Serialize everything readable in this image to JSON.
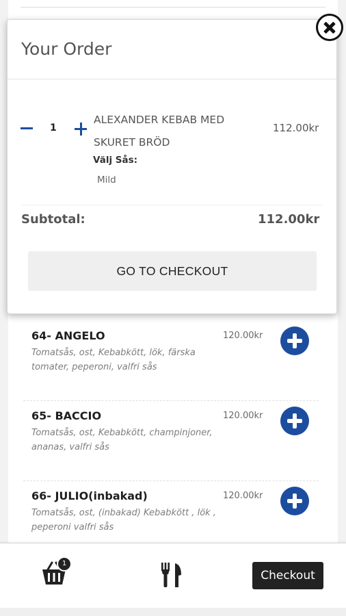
{
  "order": {
    "title": "Your Order",
    "items": [
      {
        "quantity": "1",
        "name": "ALEXANDER KEBAB MED SKURET BRÖD",
        "price": "112.00kr",
        "option_label": "Välj Sås:",
        "option_value": "Mild"
      }
    ],
    "subtotal_label": "Subtotal:",
    "subtotal_value": "112.00kr",
    "checkout_button": "GO TO CHECKOUT"
  },
  "menu": {
    "items": [
      {
        "name": "64- ANGELO",
        "description": "Tomatsås, ost, Kebabkött, lök, färska tomater, peperoni, valfri sås",
        "price": "120.00kr"
      },
      {
        "name": "65- BACCIO",
        "description": "Tomatsås, ost, Kebabkött, champinjoner, ananas, valfri sås",
        "price": "120.00kr"
      },
      {
        "name": "66- JULIO(inbakad)",
        "description": "Tomatsås, ost, (inbakad) Kebabkött , lök , peperoni valfri sås",
        "price": "120.00kr"
      }
    ]
  },
  "bottom_nav": {
    "cart_badge": "1",
    "checkout_label": "Checkout",
    "icons": [
      "cart-icon",
      "cutlery-icon"
    ]
  },
  "colors": {
    "accent_blue": "#1d4d9e",
    "dark": "#222222"
  }
}
